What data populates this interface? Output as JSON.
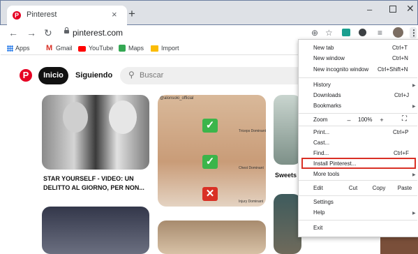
{
  "tab": {
    "title": "Pinterest",
    "favicon": "P"
  },
  "address": {
    "url": "pinterest.com"
  },
  "bookmarks": [
    {
      "label": "Apps"
    },
    {
      "label": "Gmail"
    },
    {
      "label": "YouTube"
    },
    {
      "label": "Maps"
    },
    {
      "label": "Import"
    }
  ],
  "pinterest": {
    "logo": "P",
    "nav_home": "Inicio",
    "nav_following": "Siguiendo",
    "search_placeholder": "Buscar",
    "pins": [
      {
        "caption_line1": "STAR YOURSELF - VIDEO: UN",
        "caption_line2": "DELITTO AL GIORNO, PER NON..."
      },
      {
        "tag": "@alonsoki_official",
        "label_a": "Triceps Dominant",
        "label_b": "Chest Dominant",
        "label_c": "Injury Dominant"
      },
      {
        "caption": "Sweets"
      }
    ]
  },
  "menu": {
    "new_tab": "New tab",
    "new_tab_sc": "Ctrl+T",
    "new_window": "New window",
    "new_window_sc": "Ctrl+N",
    "incognito": "New incognito window",
    "incognito_sc": "Ctrl+Shift+N",
    "history": "History",
    "downloads": "Downloads",
    "downloads_sc": "Ctrl+J",
    "bookmarks": "Bookmarks",
    "zoom": "Zoom",
    "zoom_minus": "–",
    "zoom_value": "100%",
    "zoom_plus": "+",
    "print": "Print...",
    "print_sc": "Ctrl+P",
    "cast": "Cast...",
    "find": "Find...",
    "find_sc": "Ctrl+F",
    "install": "Install Pinterest...",
    "more_tools": "More tools",
    "edit": "Edit",
    "cut": "Cut",
    "copy": "Copy",
    "paste": "Paste",
    "settings": "Settings",
    "help": "Help",
    "exit": "Exit"
  },
  "colors": {
    "pinterest_red": "#e60023",
    "highlight": "#d93025"
  }
}
